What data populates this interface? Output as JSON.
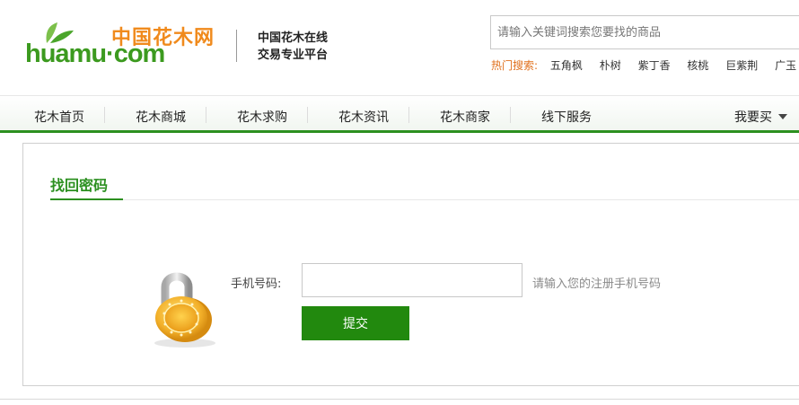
{
  "header": {
    "logo_cn": "中国花木网",
    "logo_en": "huamu·com",
    "slogan_line1": "中国花木在线",
    "slogan_line2": "交易专业平台",
    "search_placeholder": "请输入关键词搜索您要找的商品",
    "hot_label": "热门搜索:",
    "hot_items": [
      "五角枫",
      "朴树",
      "紫丁香",
      "核桃",
      "巨紫荆",
      "广玉"
    ]
  },
  "nav": {
    "items": [
      "花木首页",
      "花木商城",
      "花木求购",
      "花木资讯",
      "花木商家",
      "线下服务"
    ],
    "buy_label": "我要买"
  },
  "main": {
    "title": "找回密码",
    "phone_label": "手机号码:",
    "phone_value": "",
    "phone_hint": "请输入您的注册手机号码",
    "submit_label": "提交"
  },
  "colors": {
    "brand_green": "#2c9020",
    "brand_orange": "#f08a1c",
    "button_green": "#22890e"
  },
  "icons": {
    "lock": "padlock-icon",
    "caret": "caret-down-icon",
    "leaf": "leaf-logo-icon"
  }
}
